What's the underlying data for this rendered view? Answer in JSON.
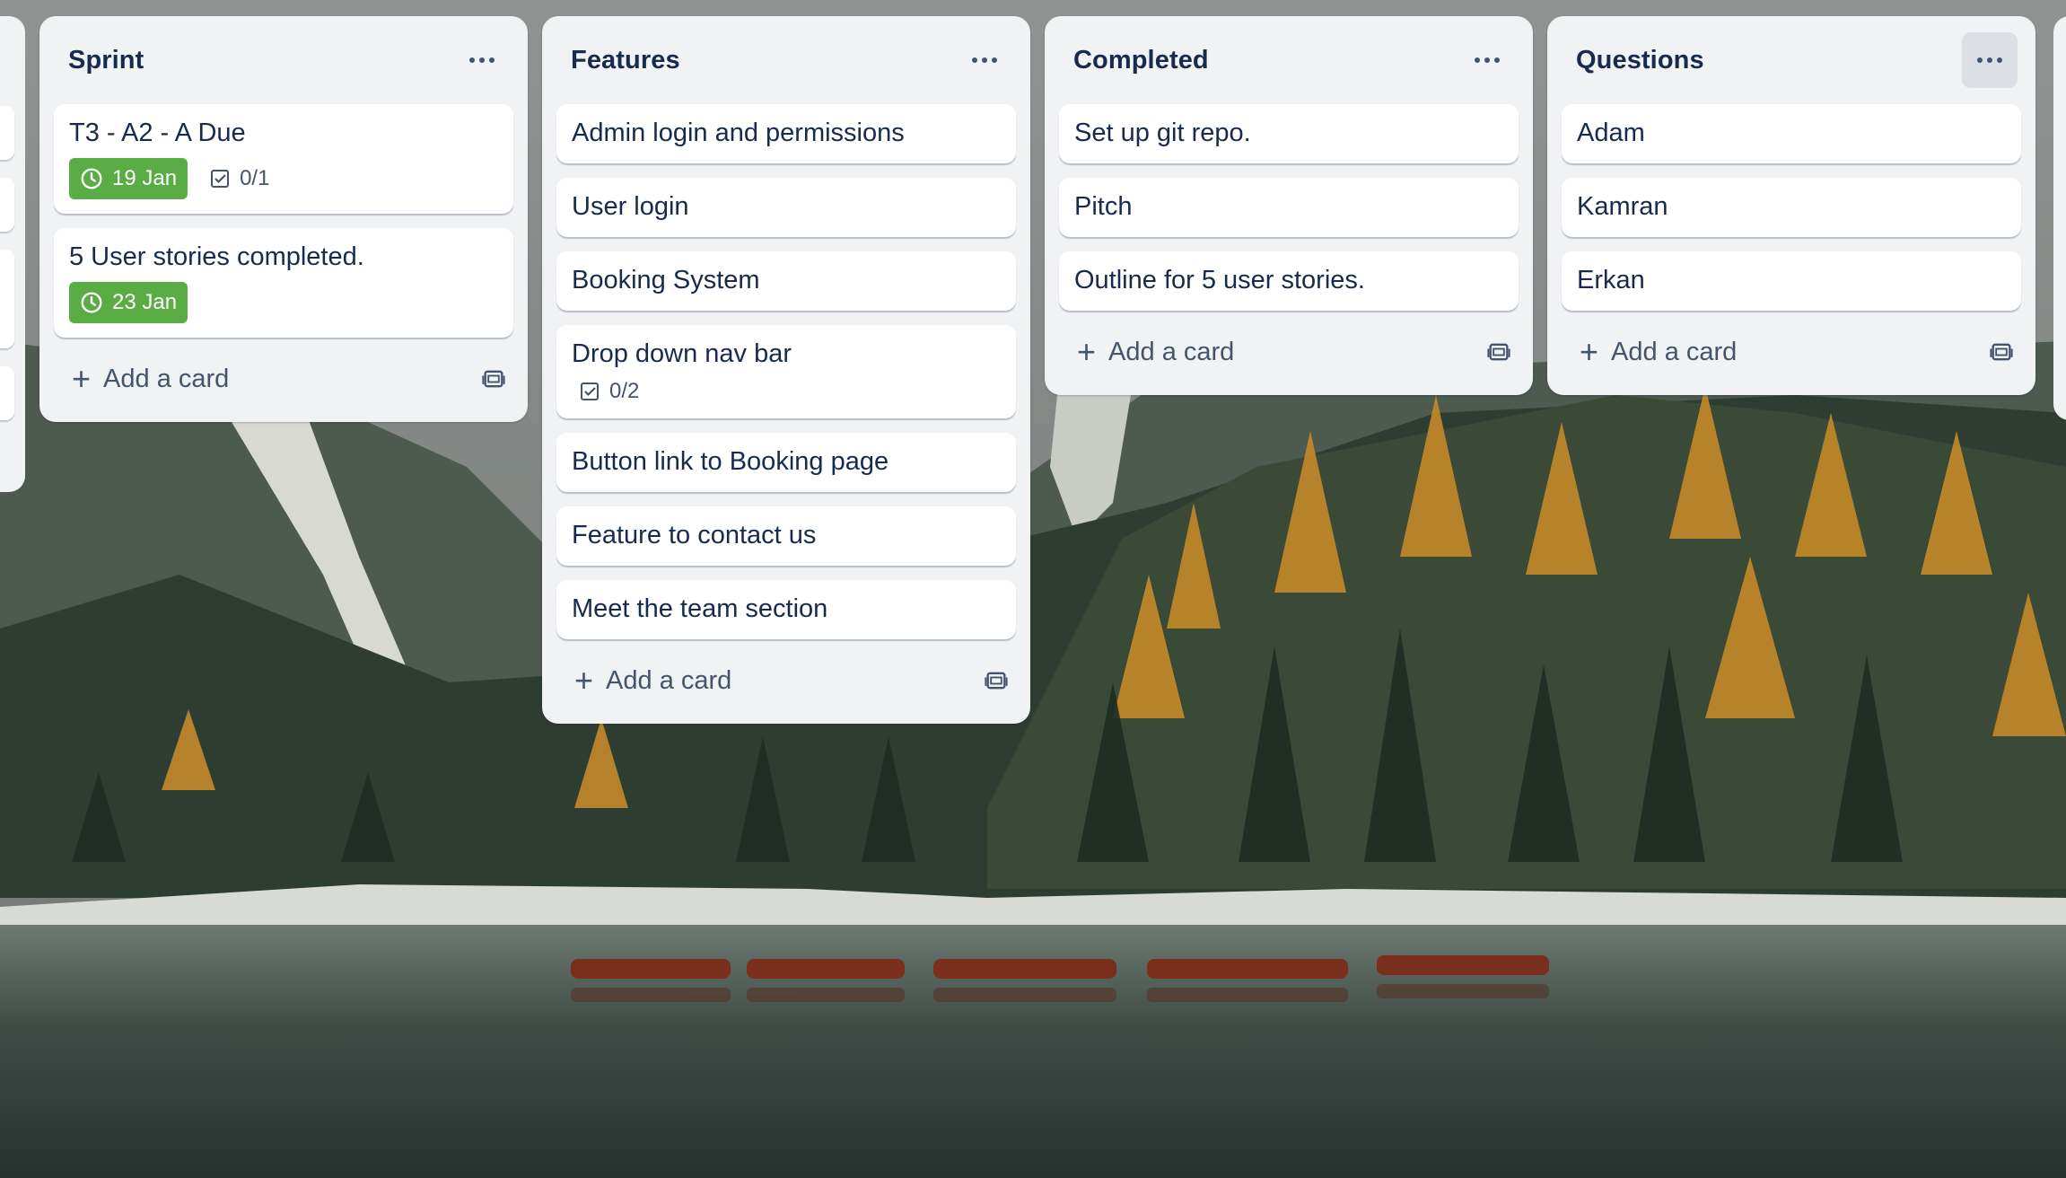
{
  "board": {
    "lists": [
      {
        "title": "Sprint",
        "cards": [
          {
            "title": "T3 - A2 - A Due",
            "due": "19 Jan",
            "checklist": "0/1"
          },
          {
            "title": "5 User stories completed.",
            "due": "23 Jan"
          }
        ],
        "add_label": "Add a card"
      },
      {
        "title": "Features",
        "cards": [
          {
            "title": "Admin login and permissions"
          },
          {
            "title": "User login"
          },
          {
            "title": "Booking System"
          },
          {
            "title": "Drop down nav bar",
            "checklist": "0/2"
          },
          {
            "title": "Button link to Booking page"
          },
          {
            "title": "Feature to contact us"
          },
          {
            "title": "Meet the team section"
          }
        ],
        "add_label": "Add a card"
      },
      {
        "title": "Completed",
        "cards": [
          {
            "title": "Set up git repo."
          },
          {
            "title": "Pitch"
          },
          {
            "title": "Outline for 5 user stories."
          }
        ],
        "add_label": "Add a card"
      },
      {
        "title": "Questions",
        "cards": [
          {
            "title": "Adam"
          },
          {
            "title": "Kamran"
          },
          {
            "title": "Erkan"
          }
        ],
        "add_label": "Add a card"
      }
    ]
  },
  "colors": {
    "list_bg": "#f1f2f4",
    "card_bg": "#ffffff",
    "due_badge": "#5aac44",
    "text": "#172b4d",
    "muted": "#44546f"
  },
  "icons": {
    "list_menu": "more-dots-icon",
    "due": "clock-icon",
    "checklist": "checkbox-icon",
    "add": "plus-icon",
    "template": "card-template-icon"
  }
}
